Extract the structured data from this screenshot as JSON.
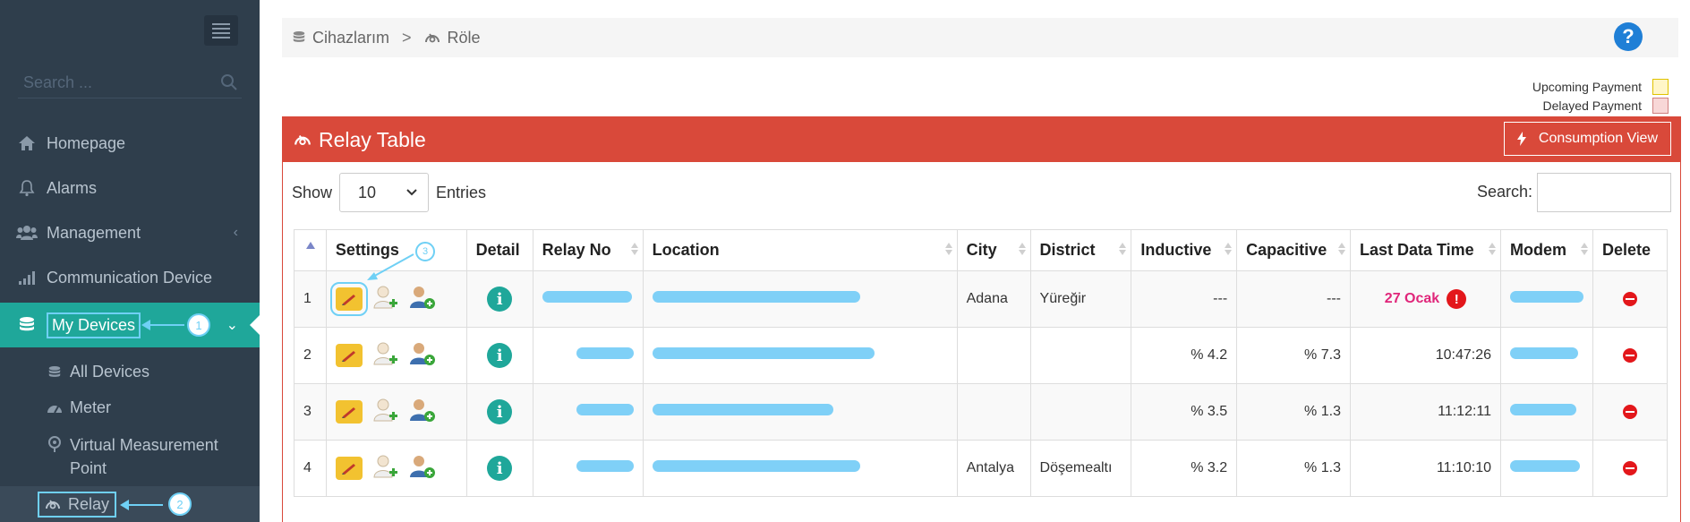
{
  "sidebar": {
    "search_placeholder": "Search ...",
    "items": [
      {
        "label": "Homepage",
        "icon": "home-icon"
      },
      {
        "label": "Alarms",
        "icon": "bell-icon"
      },
      {
        "label": "Management",
        "icon": "users-icon"
      },
      {
        "label": "Communication Device",
        "icon": "signal-icon"
      },
      {
        "label": "My Devices",
        "icon": "database-icon"
      }
    ],
    "sub_items": [
      {
        "label": "All Devices",
        "icon": "database-icon"
      },
      {
        "label": "Meter",
        "icon": "gauge-icon"
      },
      {
        "label": "Virtual Measurement Point",
        "icon": "pin-icon"
      },
      {
        "label": "Relay",
        "icon": "relay-icon"
      }
    ],
    "callouts": [
      "1",
      "2",
      "3"
    ]
  },
  "breadcrumb": {
    "items": [
      "Cihazlarım",
      "Röle"
    ],
    "separator": ">"
  },
  "legend": {
    "upcoming_label": "Upcoming Payment",
    "upcoming_color": "#fff6c8",
    "delayed_label": "Delayed Payment",
    "delayed_color": "#f8d7d7"
  },
  "panel": {
    "title": "Relay Table",
    "consumption_label": "Consumption View",
    "header_color": "#d9493a"
  },
  "controls": {
    "show_label": "Show",
    "entries_value": "10",
    "entries_label": "Entries",
    "search_label": "Search:"
  },
  "table": {
    "headers": [
      "",
      "Settings",
      "Detail",
      "Relay No",
      "Location",
      "City",
      "District",
      "Inductive",
      "Capacitive",
      "Last Data Time",
      "Modem",
      "Delete"
    ],
    "rows": [
      {
        "index": "1",
        "city": "Adana",
        "district": "Yüreğir",
        "inductive": "---",
        "capacitive": "---",
        "last_data_time": "27 Ocak"
      },
      {
        "index": "2",
        "city": "",
        "district": "",
        "inductive": "% 4.2",
        "capacitive": "% 7.3",
        "last_data_time": "10:47:26"
      },
      {
        "index": "3",
        "city": "",
        "district": "",
        "inductive": "% 3.5",
        "capacitive": "% 1.3",
        "last_data_time": "11:12:11"
      },
      {
        "index": "4",
        "city": "Antalya",
        "district": "Döşemealtı",
        "inductive": "% 3.2",
        "capacitive": "% 1.3",
        "last_data_time": "11:10:10"
      }
    ]
  },
  "help_icon_label": "?"
}
